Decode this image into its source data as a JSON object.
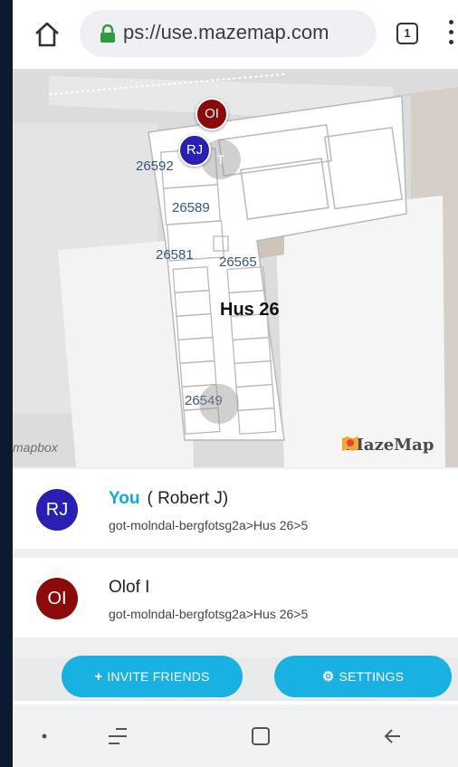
{
  "browser": {
    "url": "ps://use.mazemap.com",
    "tab_count": "1"
  },
  "map": {
    "building": "Hus 26",
    "rooms": [
      "26592",
      "26589",
      "26581",
      "26565",
      "26549"
    ],
    "markers": [
      {
        "initials": "OI",
        "color": "#8b0a0a"
      },
      {
        "initials": "RJ",
        "color": "#2a1fb3"
      }
    ],
    "ghost_initial": "T",
    "attribution": "mapbox",
    "brand": "MazeMap"
  },
  "people": [
    {
      "you_label": "You",
      "name": "( Robert J)",
      "initials": "RJ",
      "avatar_color": "#2a1fb3",
      "location": "got-molndal-bergfotsg2a>Hus 26>5"
    },
    {
      "you_label": "",
      "name": "Olof I",
      "initials": "OI",
      "avatar_color": "#8b0a0a",
      "location": "got-molndal-bergfotsg2a>Hus 26>5"
    }
  ],
  "actions": {
    "invite_label": "INVITE FRIENDS",
    "settings_label": "SETTINGS",
    "accent": "#18b1e2"
  },
  "navbar": {
    "icons": [
      "dot-icon",
      "recent-apps-icon",
      "home-square-icon",
      "back-arrow-icon"
    ]
  }
}
